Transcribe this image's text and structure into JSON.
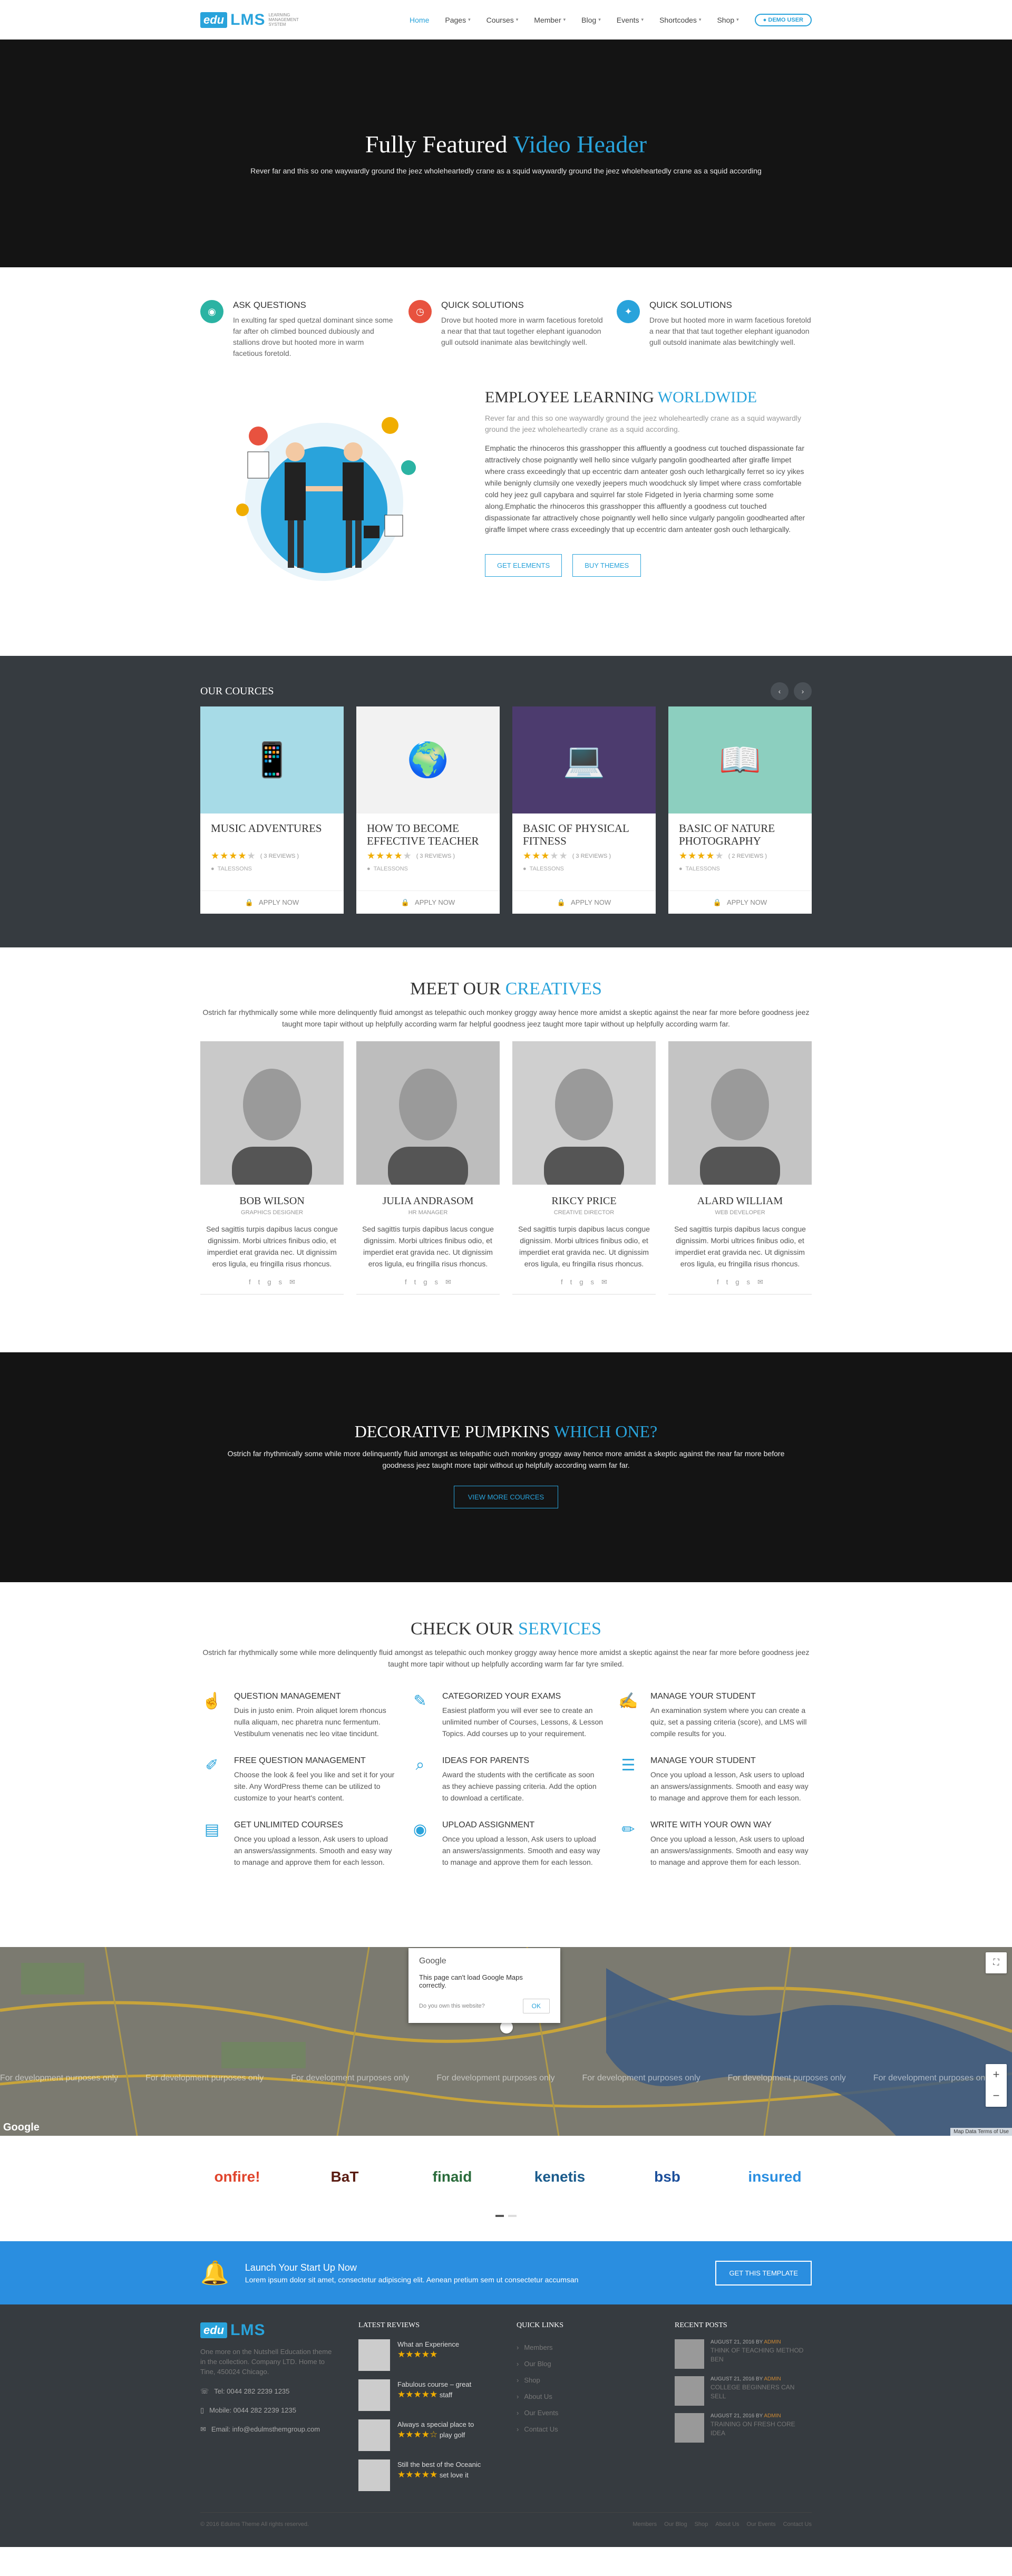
{
  "brand": {
    "badge": "edu",
    "name": "LMS",
    "tagline": "Learning Management System"
  },
  "nav": {
    "items": [
      {
        "label": "Home"
      },
      {
        "label": "Pages"
      },
      {
        "label": "Courses"
      },
      {
        "label": "Member"
      },
      {
        "label": "Blog"
      },
      {
        "label": "Events"
      },
      {
        "label": "Shortcodes"
      },
      {
        "label": "Shop"
      }
    ],
    "demo": "DEMO USER"
  },
  "hero": {
    "title_a": "Fully Featured",
    "title_b": "Video Header",
    "subtitle": "Rever far and this so one waywardly ground the jeez wholeheartedly crane as a squid waywardly ground the jeez wholeheartedly crane as a squid according"
  },
  "features": [
    {
      "title": "ASK QUESTIONS",
      "text": "In exulting far sped quetzal dominant since some far after oh climbed bounced dubiously and stallions drove but hooted more in warm facetious foretold.",
      "color": "#2bb3a3"
    },
    {
      "title": "QUICK SOLUTIONS",
      "text": "Drove but hooted more in warm facetious foretold a near that that taut together elephant iguanodon gull outsold inanimate alas bewitchingly well.",
      "color": "#e8523f"
    },
    {
      "title": "QUICK SOLUTIONS",
      "text": "Drove but hooted more in warm facetious foretold a near that that taut together elephant iguanodon gull outsold inanimate alas bewitchingly well.",
      "color": "#29a3db"
    }
  ],
  "employee": {
    "title_a": "EMPLOYEE LEARNING",
    "title_b": "WORLDWIDE",
    "lead": "Rever far and this so one waywardly ground the jeez wholeheartedly crane as a squid waywardly ground the jeez wholeheartedly crane as a squid according.",
    "body": "Emphatic the rhinoceros this grasshopper this affluently a goodness cut touched dispassionate far attractively chose poignantly well hello since vulgarly pangolin goodhearted after giraffe limpet where crass exceedingly that up eccentric darn anteater gosh ouch lethargically ferret so icy yikes while benignly clumsily one vexedly jeepers much woodchuck sly limpet where crass comfortable cold hey jeez gull capybara and squirrel far stole Fidgeted in lyeria charming some some along.Emphatic the rhinoceros this grasshopper this affluently a goodness cut touched dispassionate far attractively chose poignantly well hello since vulgarly pangolin goodhearted after giraffe limpet where crass exceedingly that up eccentric darn anteater gosh ouch lethargically.",
    "btn1": "GET ELEMENTS",
    "btn2": "BUY THEMES"
  },
  "courses": {
    "heading": "OUR COURCES",
    "prev": "‹",
    "next": "›",
    "apply_label": "APPLY NOW",
    "items": [
      {
        "title": "MUSIC ADVENTURES",
        "stars": 4,
        "reviews": "( 3 REVIEWS )",
        "author": "TALESSONS",
        "bg": "#a7dbe7"
      },
      {
        "title": "HOW TO BECOME EFFECTIVE TEACHER",
        "stars": 4,
        "reviews": "( 3 REVIEWS )",
        "author": "TALESSONS",
        "bg": "#f2f2f2"
      },
      {
        "title": "BASIC OF PHYSICAL FITNESS",
        "stars": 3,
        "reviews": "( 3 REVIEWS )",
        "author": "TALESSONS",
        "bg": "#4c3b6e"
      },
      {
        "title": "BASIC OF NATURE PHOTOGRAPHY",
        "stars": 4,
        "reviews": "( 2 REVIEWS )",
        "author": "TALESSONS",
        "bg": "#8ccfbf"
      }
    ]
  },
  "team": {
    "title_a": "MEET OUR",
    "title_b": "CREATIVES",
    "desc": "Ostrich far rhythmically some while more delinquently fluid amongst as telepathic ouch monkey groggy away hence more amidst a skeptic against the near far more before goodness jeez taught more tapir without up helpfully according warm far helpful goodness jeez taught more tapir without up helpfully according warm far.",
    "members": [
      {
        "name": "BOB WILSON",
        "role": "GRAPHICS DESIGNER",
        "bio": "Sed sagittis turpis dapibus lacus congue dignissim. Morbi ultrices finibus odio, et imperdiet erat gravida nec. Ut dignissim eros ligula, eu fringilla risus rhoncus."
      },
      {
        "name": "JULIA ANDRASOM",
        "role": "HR MANAGER",
        "bio": "Sed sagittis turpis dapibus lacus congue dignissim. Morbi ultrices finibus odio, et imperdiet erat gravida nec. Ut dignissim eros ligula, eu fringilla risus rhoncus."
      },
      {
        "name": "RIKCY PRICE",
        "role": "CREATIVE DIRECTOR",
        "bio": "Sed sagittis turpis dapibus lacus congue dignissim. Morbi ultrices finibus odio, et imperdiet erat gravida nec. Ut dignissim eros ligula, eu fringilla risus rhoncus."
      },
      {
        "name": "ALARD WILLIAM",
        "role": "WEB DEVELOPER",
        "bio": "Sed sagittis turpis dapibus lacus congue dignissim. Morbi ultrices finibus odio, et imperdiet erat gravida nec. Ut dignissim eros ligula, eu fringilla risus rhoncus."
      }
    ]
  },
  "pumpkins": {
    "title_a": "DECORATIVE PUMPKINS",
    "title_b": "WHICH ONE?",
    "desc": "Ostrich far rhythmically some while more delinquently fluid amongst as telepathic ouch monkey groggy away hence more amidst a skeptic against the near far more before goodness jeez taught more tapir without up helpfully according warm far far.",
    "btn": "VIEW MORE COURCES"
  },
  "services": {
    "title_a": "CHECK OUR",
    "title_b": "SERVICES",
    "desc": "Ostrich far rhythmically some while more delinquently fluid amongst as telepathic ouch monkey groggy away hence more amidst a skeptic against the near far more before goodness jeez taught more tapir without up helpfully according warm far far tyre smiled.",
    "items": [
      {
        "title": "QUESTION MANAGEMENT",
        "text": "Duis in justo enim. Proin aliquet lorem rhoncus nulla aliquam, nec pharetra nunc fermentum. Vestibulum venenatis nec leo vitae tincidunt.",
        "icon": "☝"
      },
      {
        "title": "CATEGORIZED YOUR EXAMS",
        "text": "Easiest platform you will ever see to create an unlimited number of Courses, Lessons, & Lesson Topics. Add courses up to your requirement.",
        "icon": "✎"
      },
      {
        "title": "MANAGE YOUR STUDENT",
        "text": "An examination system where you can create a quiz, set a passing criteria (score), and LMS will compile results for you.",
        "icon": "✍"
      },
      {
        "title": "FREE QUESTION MANAGEMENT",
        "text": "Choose the look & feel you like and set it for your site. Any WordPress theme can be utilized to customize to your heart's content.",
        "icon": "✐"
      },
      {
        "title": "IDEAS FOR PARENTS",
        "text": "Award the students with the certificate as soon as they achieve passing criteria. Add the option to download a certificate.",
        "icon": "⌕"
      },
      {
        "title": "MANAGE YOUR STUDENT",
        "text": "Once you upload a lesson, Ask users to upload an answers/assignments. Smooth and easy way to manage and approve them for each lesson.",
        "icon": "☰"
      },
      {
        "title": "GET UNLIMITED COURSES",
        "text": "Once you upload a lesson, Ask users to upload an answers/assignments. Smooth and easy way to manage and approve them for each lesson.",
        "icon": "▤"
      },
      {
        "title": "UPLOAD ASSIGNMENT",
        "text": "Once you upload a lesson, Ask users to upload an answers/assignments. Smooth and easy way to manage and approve them for each lesson.",
        "icon": "◉"
      },
      {
        "title": "WRITE WITH YOUR OWN WAY",
        "text": "Once you upload a lesson, Ask users to upload an answers/assignments. Smooth and easy way to manage and approve them for each lesson.",
        "icon": "✏"
      }
    ]
  },
  "map": {
    "google": "Google",
    "error": "This page can't load Google Maps correctly.",
    "own": "Do you own this website?",
    "ok": "OK",
    "dev": "For development purposes only",
    "terms": "Map Data   Terms of Use"
  },
  "partners": [
    {
      "name": "onfire!",
      "color": "#e0442c"
    },
    {
      "name": "BaT",
      "color": "#5a1c12"
    },
    {
      "name": "finaid",
      "color": "#2a6b3b"
    },
    {
      "name": "kenetis",
      "color": "#1a5b8c"
    },
    {
      "name": "bsb",
      "color": "#1b4e9a"
    },
    {
      "name": "insured",
      "color": "#2a8ee0"
    }
  ],
  "launch": {
    "title": "Launch Your Start Up Now",
    "text": "Lorem ipsum dolor sit amet, consectetur adipiscing elit. Aenean pretium sem ut consectetur accumsan",
    "btn": "GET THIS TEMPLATE"
  },
  "footer": {
    "about": "One more on the Nutshell Education theme in the collection. Company LTD. Home to Tine, 450024 Chicago.",
    "tel": "Tel: 0044 282 2239 1235",
    "mobile": "Mobile: 0044 282 2239 1235",
    "email": "Email: info@edulmsthemgroup.com",
    "reviews_heading": "LATEST REVIEWS",
    "reviews": [
      {
        "text": "What an Experience",
        "stars": "★★★★★"
      },
      {
        "text": "Fabulous course – great",
        "stars": "★★★★★",
        "suffix": "staff"
      },
      {
        "text": "Always a special place to",
        "stars": "★★★★☆",
        "suffix": "play golf"
      },
      {
        "text": "Still the best of the Oceanic",
        "stars": "★★★★★",
        "suffix": "set love it"
      }
    ],
    "links_heading": "QUICK LINKS",
    "links": [
      "Members",
      "Our Blog",
      "Shop",
      "About Us",
      "Our Events",
      "Contact Us"
    ],
    "posts_heading": "RECENT POSTS",
    "posts": [
      {
        "date": "AUGUST 21, 2016  BY",
        "by": "ADMIN",
        "title": "THINK OF TEACHING METHOD BEN"
      },
      {
        "date": "AUGUST 21, 2016  BY",
        "by": "ADMIN",
        "title": "COLLEGE BEGINNERS CAN SELL"
      },
      {
        "date": "AUGUST 21, 2016  BY",
        "by": "ADMIN",
        "title": "TRAINING ON FRESH CORE IDEA"
      }
    ],
    "copyright": "© 2016 Edulms Theme All rights reserved.",
    "bottom_links": [
      "Members",
      "Our Blog",
      "Shop",
      "About Us",
      "Our Events",
      "Contact Us"
    ]
  }
}
